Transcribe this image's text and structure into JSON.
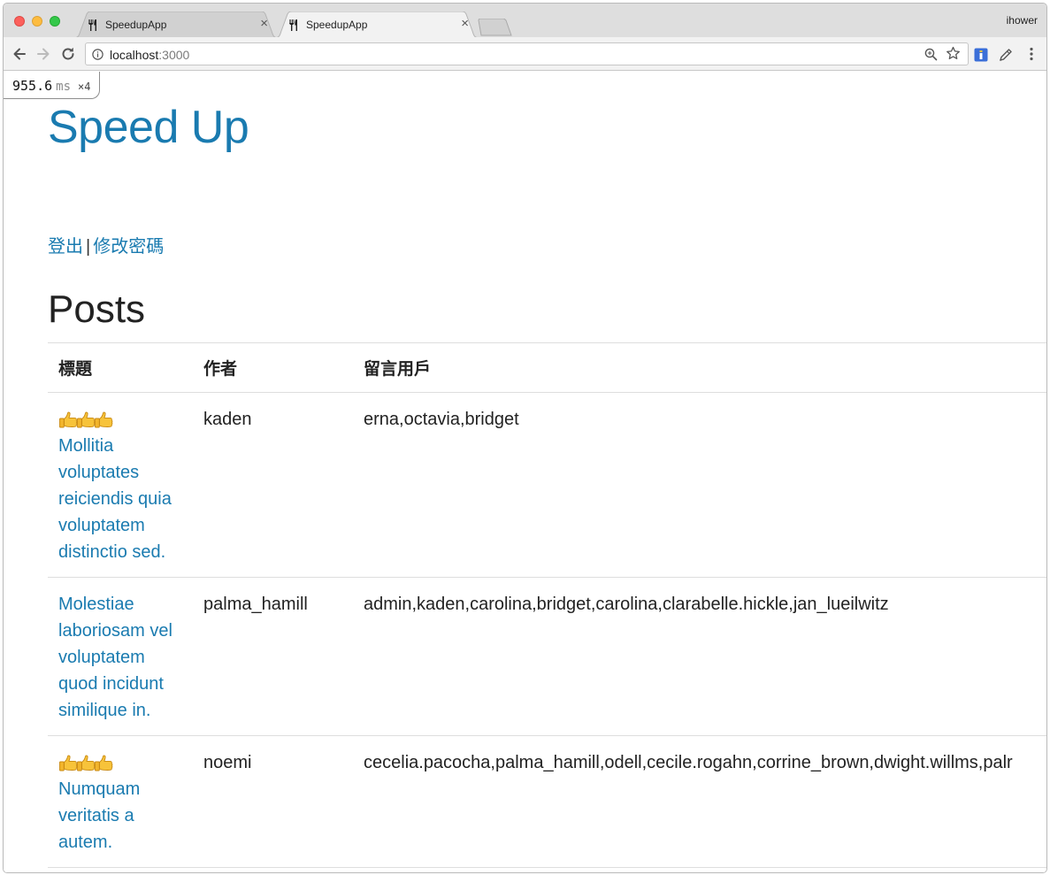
{
  "browser": {
    "tabs": [
      {
        "title": "SpeedupApp",
        "close": "×",
        "active": false
      },
      {
        "title": "SpeedupApp",
        "close": "×",
        "active": true
      }
    ],
    "profile_name": "ihower",
    "address": {
      "host": "localhost",
      "port": ":3000"
    }
  },
  "profiler": {
    "value": "955.6",
    "unit": "ms",
    "count": "×4"
  },
  "page": {
    "site_title": "Speed Up",
    "links": {
      "logout": "登出",
      "separator": "|",
      "change_password": "修改密碼"
    },
    "heading": "Posts"
  },
  "table": {
    "headers": [
      "標題",
      "作者",
      "留言用戶"
    ],
    "rows": [
      {
        "thumbs": 3,
        "title": "Mollitia voluptates reiciendis quia voluptatem distinctio sed.",
        "author": "kaden",
        "commenters": "erna,octavia,bridget"
      },
      {
        "thumbs": 0,
        "title": "Molestiae laboriosam vel voluptatem quod incidunt similique in.",
        "author": "palma_hamill",
        "commenters": "admin,kaden,carolina,bridget,carolina,clarabelle.hickle,jan_lueilwitz"
      },
      {
        "thumbs": 3,
        "title": "Numquam veritatis a autem.",
        "author": "noemi",
        "commenters": "cecelia.pacocha,palma_hamill,odell,cecile.rogahn,corrine_brown,dwight.willms,palr"
      }
    ]
  },
  "colors": {
    "link": "#1a7bb0",
    "text": "#222222",
    "tabstrip": "#dedede",
    "toolbar": "#f2f2f2"
  },
  "icons": [
    "fork-knife-favicon",
    "back-arrow-icon",
    "forward-arrow-icon",
    "reload-icon",
    "info-icon",
    "zoom-icon",
    "star-icon",
    "extension-icon",
    "pen-icon",
    "menu-icon",
    "thumbs-up-icon"
  ]
}
